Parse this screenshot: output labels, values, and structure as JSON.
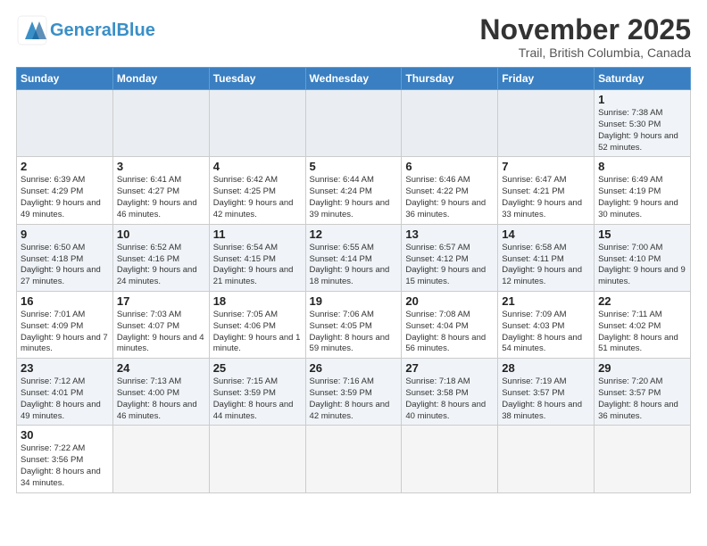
{
  "header": {
    "logo_general": "General",
    "logo_blue": "Blue",
    "month_title": "November 2025",
    "subtitle": "Trail, British Columbia, Canada"
  },
  "weekdays": [
    "Sunday",
    "Monday",
    "Tuesday",
    "Wednesday",
    "Thursday",
    "Friday",
    "Saturday"
  ],
  "weeks": [
    [
      {
        "day": "",
        "info": ""
      },
      {
        "day": "",
        "info": ""
      },
      {
        "day": "",
        "info": ""
      },
      {
        "day": "",
        "info": ""
      },
      {
        "day": "",
        "info": ""
      },
      {
        "day": "",
        "info": ""
      },
      {
        "day": "1",
        "info": "Sunrise: 7:38 AM\nSunset: 5:30 PM\nDaylight: 9 hours\nand 52 minutes."
      }
    ],
    [
      {
        "day": "2",
        "info": "Sunrise: 6:39 AM\nSunset: 4:29 PM\nDaylight: 9 hours\nand 49 minutes."
      },
      {
        "day": "3",
        "info": "Sunrise: 6:41 AM\nSunset: 4:27 PM\nDaylight: 9 hours\nand 46 minutes."
      },
      {
        "day": "4",
        "info": "Sunrise: 6:42 AM\nSunset: 4:25 PM\nDaylight: 9 hours\nand 42 minutes."
      },
      {
        "day": "5",
        "info": "Sunrise: 6:44 AM\nSunset: 4:24 PM\nDaylight: 9 hours\nand 39 minutes."
      },
      {
        "day": "6",
        "info": "Sunrise: 6:46 AM\nSunset: 4:22 PM\nDaylight: 9 hours\nand 36 minutes."
      },
      {
        "day": "7",
        "info": "Sunrise: 6:47 AM\nSunset: 4:21 PM\nDaylight: 9 hours\nand 33 minutes."
      },
      {
        "day": "8",
        "info": "Sunrise: 6:49 AM\nSunset: 4:19 PM\nDaylight: 9 hours\nand 30 minutes."
      }
    ],
    [
      {
        "day": "9",
        "info": "Sunrise: 6:50 AM\nSunset: 4:18 PM\nDaylight: 9 hours\nand 27 minutes."
      },
      {
        "day": "10",
        "info": "Sunrise: 6:52 AM\nSunset: 4:16 PM\nDaylight: 9 hours\nand 24 minutes."
      },
      {
        "day": "11",
        "info": "Sunrise: 6:54 AM\nSunset: 4:15 PM\nDaylight: 9 hours\nand 21 minutes."
      },
      {
        "day": "12",
        "info": "Sunrise: 6:55 AM\nSunset: 4:14 PM\nDaylight: 9 hours\nand 18 minutes."
      },
      {
        "day": "13",
        "info": "Sunrise: 6:57 AM\nSunset: 4:12 PM\nDaylight: 9 hours\nand 15 minutes."
      },
      {
        "day": "14",
        "info": "Sunrise: 6:58 AM\nSunset: 4:11 PM\nDaylight: 9 hours\nand 12 minutes."
      },
      {
        "day": "15",
        "info": "Sunrise: 7:00 AM\nSunset: 4:10 PM\nDaylight: 9 hours\nand 9 minutes."
      }
    ],
    [
      {
        "day": "16",
        "info": "Sunrise: 7:01 AM\nSunset: 4:09 PM\nDaylight: 9 hours\nand 7 minutes."
      },
      {
        "day": "17",
        "info": "Sunrise: 7:03 AM\nSunset: 4:07 PM\nDaylight: 9 hours\nand 4 minutes."
      },
      {
        "day": "18",
        "info": "Sunrise: 7:05 AM\nSunset: 4:06 PM\nDaylight: 9 hours\nand 1 minute."
      },
      {
        "day": "19",
        "info": "Sunrise: 7:06 AM\nSunset: 4:05 PM\nDaylight: 8 hours\nand 59 minutes."
      },
      {
        "day": "20",
        "info": "Sunrise: 7:08 AM\nSunset: 4:04 PM\nDaylight: 8 hours\nand 56 minutes."
      },
      {
        "day": "21",
        "info": "Sunrise: 7:09 AM\nSunset: 4:03 PM\nDaylight: 8 hours\nand 54 minutes."
      },
      {
        "day": "22",
        "info": "Sunrise: 7:11 AM\nSunset: 4:02 PM\nDaylight: 8 hours\nand 51 minutes."
      }
    ],
    [
      {
        "day": "23",
        "info": "Sunrise: 7:12 AM\nSunset: 4:01 PM\nDaylight: 8 hours\nand 49 minutes."
      },
      {
        "day": "24",
        "info": "Sunrise: 7:13 AM\nSunset: 4:00 PM\nDaylight: 8 hours\nand 46 minutes."
      },
      {
        "day": "25",
        "info": "Sunrise: 7:15 AM\nSunset: 3:59 PM\nDaylight: 8 hours\nand 44 minutes."
      },
      {
        "day": "26",
        "info": "Sunrise: 7:16 AM\nSunset: 3:59 PM\nDaylight: 8 hours\nand 42 minutes."
      },
      {
        "day": "27",
        "info": "Sunrise: 7:18 AM\nSunset: 3:58 PM\nDaylight: 8 hours\nand 40 minutes."
      },
      {
        "day": "28",
        "info": "Sunrise: 7:19 AM\nSunset: 3:57 PM\nDaylight: 8 hours\nand 38 minutes."
      },
      {
        "day": "29",
        "info": "Sunrise: 7:20 AM\nSunset: 3:57 PM\nDaylight: 8 hours\nand 36 minutes."
      }
    ],
    [
      {
        "day": "30",
        "info": "Sunrise: 7:22 AM\nSunset: 3:56 PM\nDaylight: 8 hours\nand 34 minutes."
      },
      {
        "day": "",
        "info": ""
      },
      {
        "day": "",
        "info": ""
      },
      {
        "day": "",
        "info": ""
      },
      {
        "day": "",
        "info": ""
      },
      {
        "day": "",
        "info": ""
      },
      {
        "day": "",
        "info": ""
      }
    ]
  ]
}
